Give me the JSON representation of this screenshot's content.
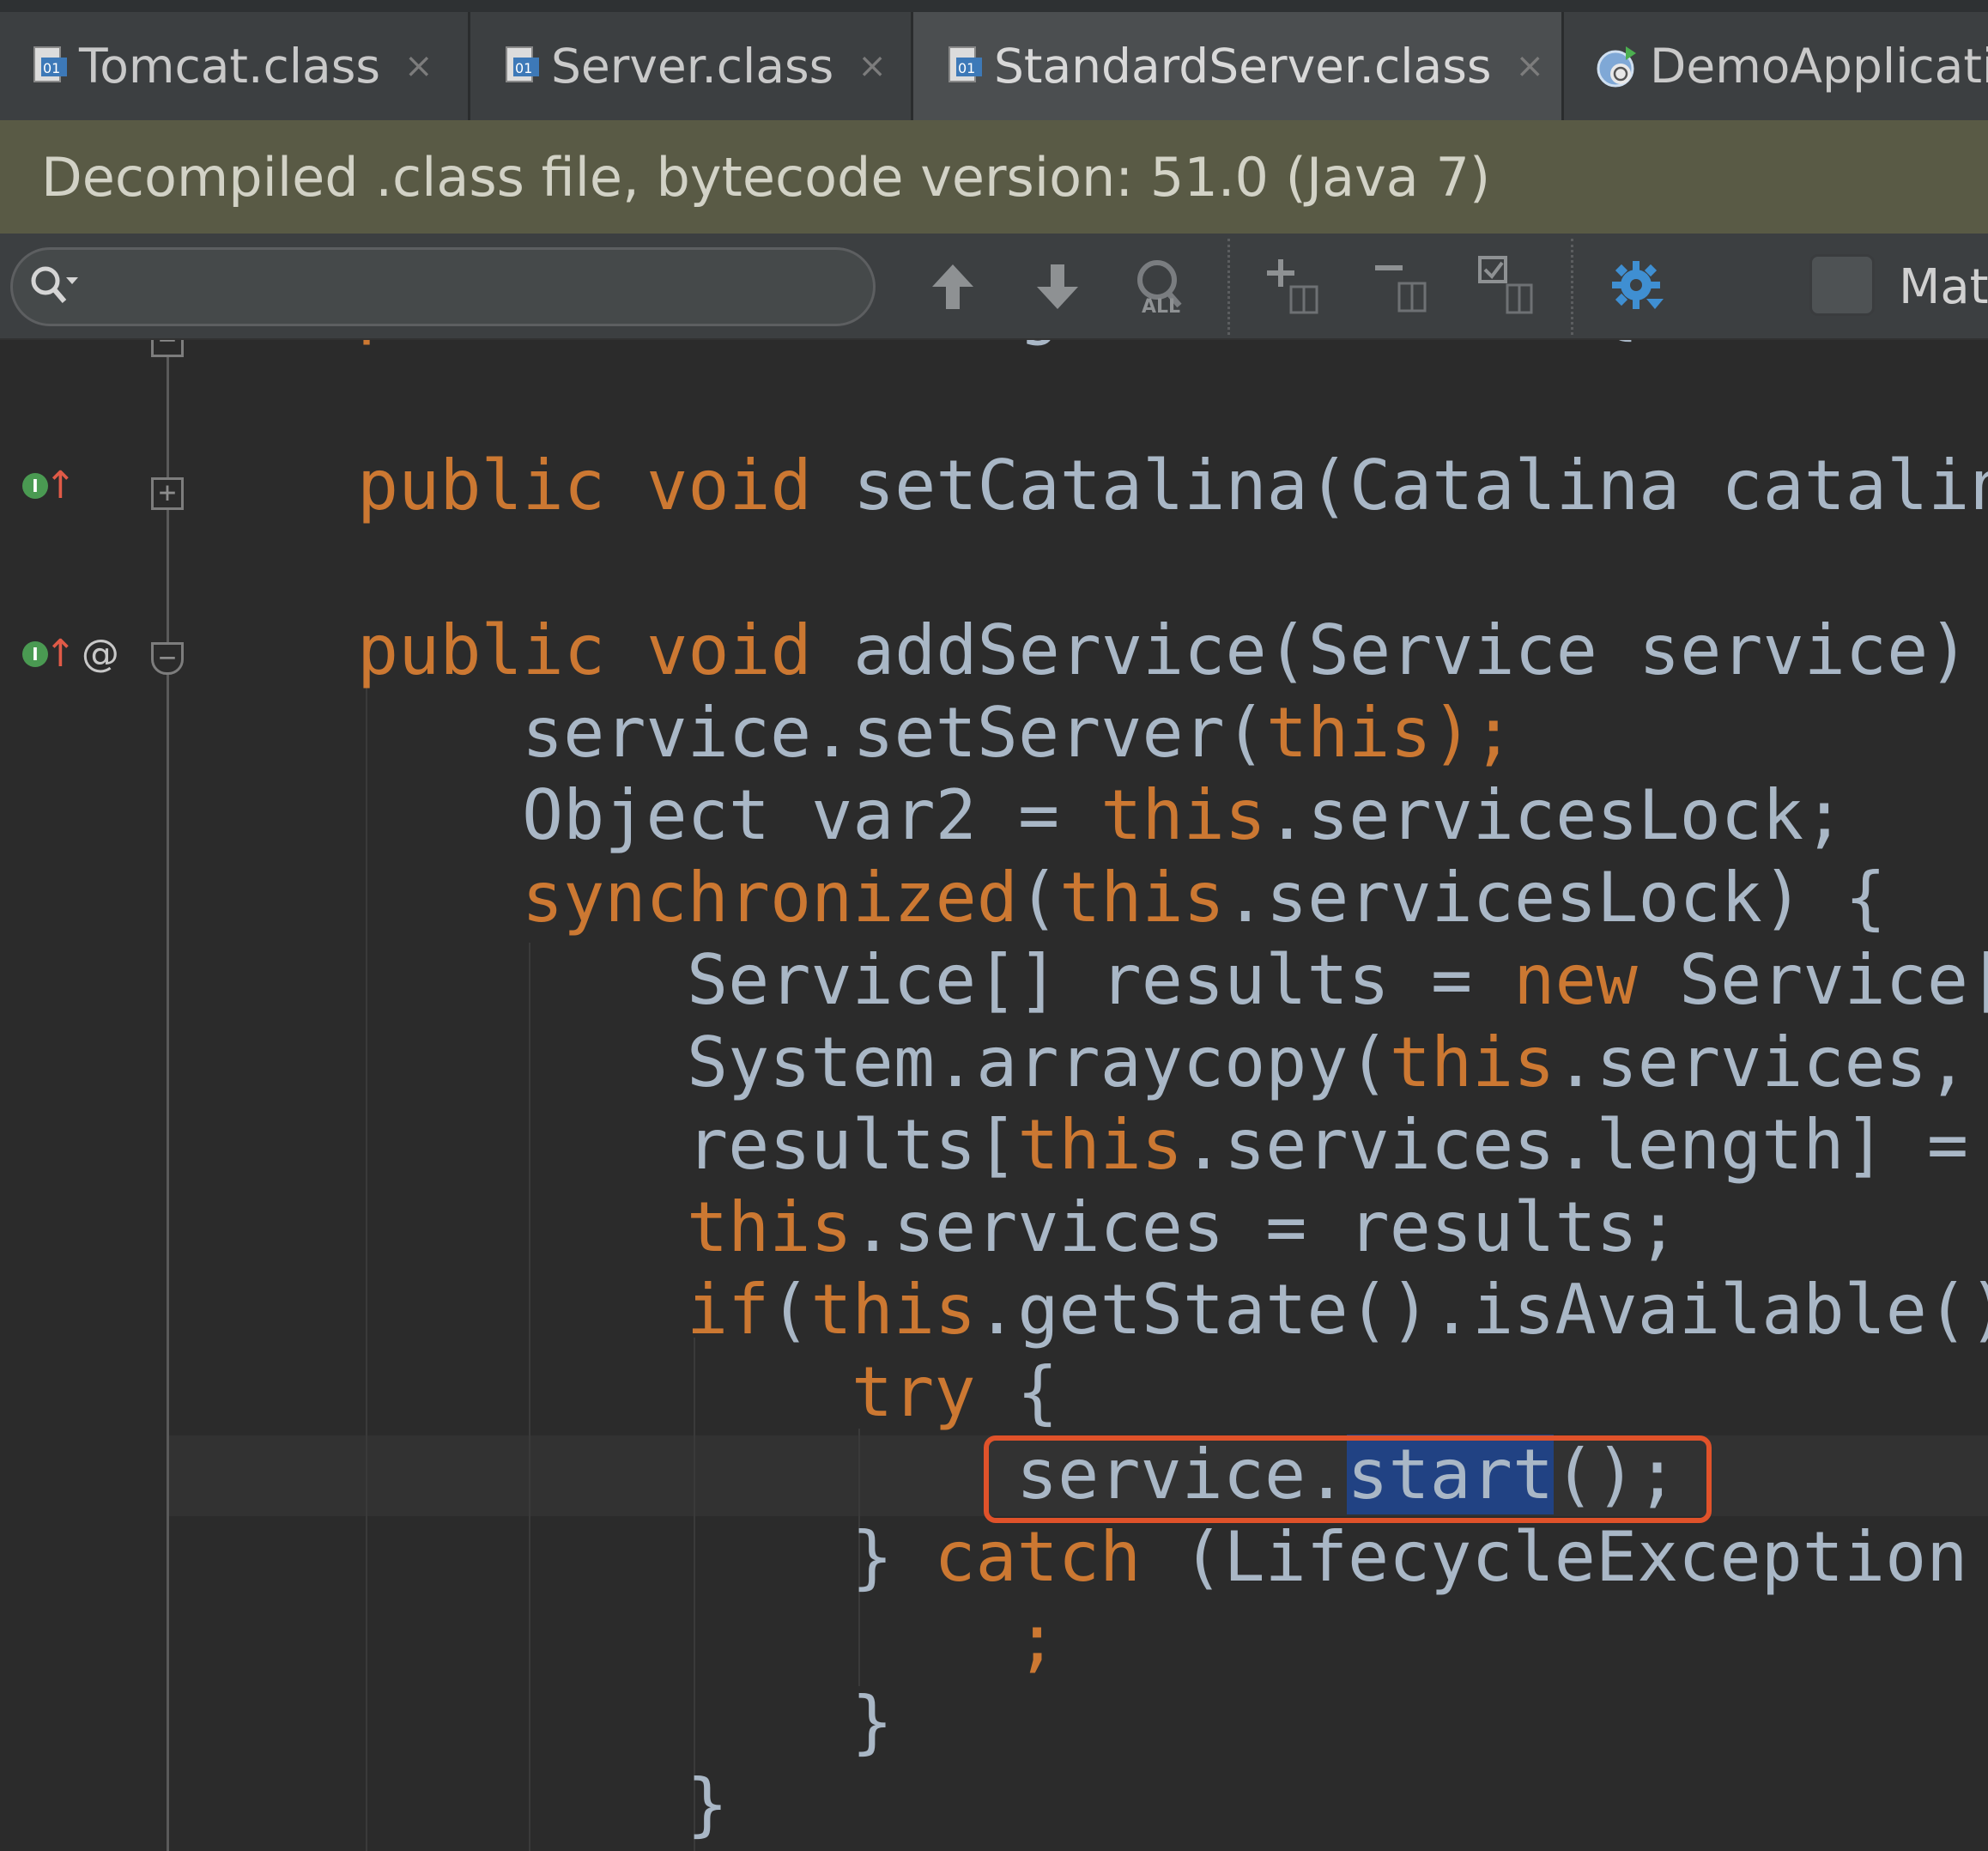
{
  "tabs": [
    {
      "label": "Tomcat.class",
      "close": "×"
    },
    {
      "label": "Server.class",
      "close": "×"
    },
    {
      "label": "StandardServer.class",
      "close": "×"
    },
    {
      "label": "DemoApplicati"
    }
  ],
  "banner": {
    "text": "Decompiled .class file, bytecode version: 51.0 (Java 7)"
  },
  "search": {
    "placeholder": "",
    "match_case_label": "Mat",
    "icons": [
      "search-icon",
      "arrow-up-icon",
      "arrow-down-icon",
      "find-all-icon",
      "add-selection-icon",
      "remove-selection-icon",
      "select-all-occurrences-icon",
      "settings-gear-icon"
    ]
  },
  "gutter": {
    "implements_marker": "I",
    "override_marker": "@"
  },
  "code": {
    "line0": {
      "kw": "public ",
      "rest": "Catalina getCatalina() { return c"
    },
    "line1": {
      "kw1": "public ",
      "kw2": "void ",
      "rest": "setCatalina(Catalina catalin"
    },
    "line2": {
      "kw1": "public ",
      "kw2": "void ",
      "rest": "addService(Service service) {"
    },
    "line3": {
      "a": "service.setServer(",
      "kw": "this",
      "b": ");"
    },
    "line4": {
      "a": "Object var2 = ",
      "kw": "this",
      "b": ".servicesLock;"
    },
    "line5": {
      "kw": "synchronized",
      "a": "(",
      "kw2": "this",
      "b": ".servicesLock) {"
    },
    "line6": {
      "a": "Service[] results = ",
      "kw": "new",
      "b": " Service["
    },
    "line7": {
      "a": "System.arraycopy(",
      "kw": "this",
      "b": ".services,"
    },
    "line8": {
      "a": "results[",
      "kw": "this",
      "b": ".services.length] ="
    },
    "line9": {
      "kw": "this",
      "b": ".services = results;"
    },
    "line10": {
      "kw": "if",
      "a": "(",
      "kw2": "this",
      "b": ".getState().isAvailable()"
    },
    "line11": {
      "kw": "try",
      "b": " {"
    },
    "line12": {
      "a": "service.",
      "sel": "start",
      "b": "();"
    },
    "line13": {
      "a": "} ",
      "kw": "catch",
      "b": " (LifecycleException"
    },
    "line14": {
      "kw": ";"
    },
    "line15": {
      "a": "}"
    },
    "line16": {
      "a": "}"
    }
  }
}
